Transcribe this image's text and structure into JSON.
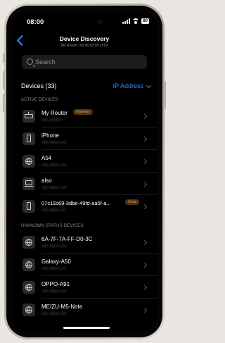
{
  "status_bar": {
    "time": "08:00",
    "battery": "80"
  },
  "nav": {
    "title": "Device Discovery",
    "subtitle": "My Router | 60:45:02:05:1f:69"
  },
  "search": {
    "placeholder": "Search"
  },
  "devices_header": {
    "count_label": "Devices (33)",
    "sort_label": "IP Address"
  },
  "sections": {
    "active": "ACTIVE DEVICES",
    "unknown": "UNKNOWN STATUS DEVICES"
  },
  "active_devices": [
    {
      "name": "My Router",
      "ip": "192.168.8.1",
      "icon": "router-icon",
      "badge": "Gateway"
    },
    {
      "name": "iPhone",
      "ip": "192.168.8.103",
      "icon": "phone-icon",
      "badge": ""
    },
    {
      "name": "A54",
      "ip": "192.168.8.126",
      "icon": "globe-icon",
      "badge": ""
    },
    {
      "name": "also",
      "ip": "192.168.8.134",
      "icon": "laptop-icon",
      "badge": ""
    },
    {
      "name": "07c11b69-3dbe-49fd-aa5f-a...",
      "ip": "192.168.8.137",
      "icon": "phone-icon",
      "badge": "Used"
    }
  ],
  "unknown_devices": [
    {
      "name": "6A-7F-7A-FF-D0-3C",
      "ip": "192.168.8.100",
      "icon": "globe-icon"
    },
    {
      "name": "Galaxy-A50",
      "ip": "192.168.8.101",
      "icon": "globe-icon"
    },
    {
      "name": "OPPO-A91",
      "ip": "192.168.8.102",
      "icon": "globe-icon"
    },
    {
      "name": "MEIZU-M5-Note",
      "ip": "192.168.8.104",
      "icon": "globe-icon"
    }
  ],
  "colors": {
    "accent": "#2f8bff",
    "badge_bg": "#4a3516",
    "badge_text": "#e0a046",
    "background": "#000000"
  }
}
